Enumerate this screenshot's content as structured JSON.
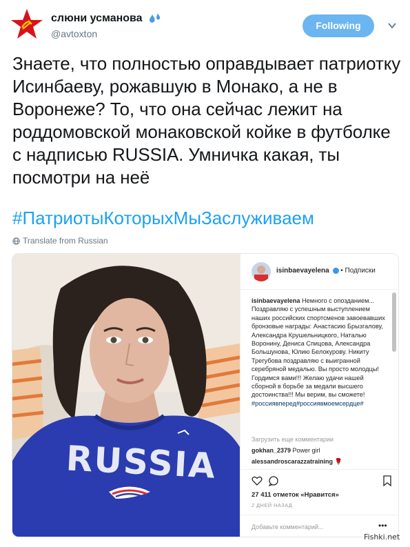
{
  "user": {
    "display_name": "слюни усманова",
    "handle": "@avtoxton",
    "avatar_icon": "red-star-hammer-sickle-icon",
    "emoji_icon": "sweat-droplets-icon"
  },
  "follow_label": "Following",
  "tweet": {
    "text": "Знаете, что полностью оправдывает патриотку Исинбаеву, рожавшую в Монако, а не в Воронеже? То, что она сейчас лежит на роддомовской монаковской койке в футболке с надписью RUSSIA. Умничка какая, ты посмотри на неё",
    "hashtag": "#ПатриотыКоторыхМыЗаслуживаем",
    "translate": "Translate from Russian"
  },
  "media": {
    "photo_shirt_text": "RUSSIA",
    "ig": {
      "username": "isinbaevayelena",
      "follow": "• Подписки",
      "caption_user": "isinbaevayelena",
      "caption": "Немного с опозданием... Поздравляю с успешным выступлением наших российских спортсменов завоевавших бронзовые награды: Анастасию Брызгалову, Александра Крушельницкого, Наталью Воронину, Дениса Спицова, Александра Большунова, Юлию Белокурову. Никиту Трегубова поздравляю с выигранной серебряной медалью. Вы просто молодцы! Гордимся вами!!! Желаю удачи нашей сборной в борьбе за медали высшего достоинства!!! Мы верим, вы сможете!",
      "tags": "#россиявперед#россиявмоемсердце#",
      "load_more": "Загрузить еще комментарии",
      "comments": [
        {
          "user": "gokhan_2379",
          "text": "Power girl"
        },
        {
          "user": "alessandroscarazzatraining",
          "text": "🌹"
        }
      ],
      "likes": "27 411 отметок «Нравится»",
      "date": "2 ДНЕЙ НАЗАД",
      "add_comment_placeholder": "Добавьте комментарий...",
      "more_dots": "•••"
    }
  },
  "watermark": "Fishki.net",
  "colors": {
    "accent": "#1da1f2",
    "follow_bg": "#6bb5f0",
    "shirt_blue": "#2a3cb0"
  }
}
